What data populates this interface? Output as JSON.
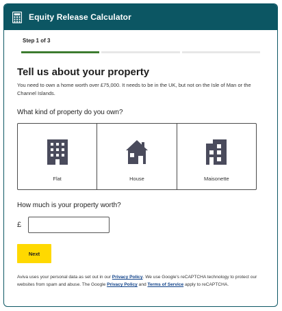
{
  "header": {
    "title": "Equity Release Calculator",
    "icon": "calculator-icon"
  },
  "step": {
    "label": "Step 1 of 3",
    "current": 1,
    "total": 3
  },
  "heading": "Tell us about your property",
  "intro": "You need to own a home worth over £75,000. It needs to be in the UK, but not on the Isle of Man or the Channel Islands.",
  "property_question": "What kind of property do you own?",
  "property_options": [
    {
      "label": "Flat",
      "icon": "flat-building-icon"
    },
    {
      "label": "House",
      "icon": "house-icon"
    },
    {
      "label": "Maisonette",
      "icon": "maisonette-icon"
    }
  ],
  "worth_question": "How much is your property worth?",
  "currency_symbol": "£",
  "worth_value": "",
  "next_label": "Next",
  "footer": {
    "text1": "Aviva uses your personal data as set out in our ",
    "link1": "Privacy Policy",
    "text2": ". We use Google's reCAPTCHA technology to protect our websites from spam and abuse. The Google ",
    "link2": "Privacy Policy",
    "text3": " and ",
    "link3": "Terms of Service",
    "text4": " apply to reCAPTCHA."
  },
  "colors": {
    "header_bg": "#0c5663",
    "progress_active": "#3d7c2f",
    "button_bg": "#ffd900",
    "icon": "#4a4b5c",
    "link": "#0c3f87"
  }
}
